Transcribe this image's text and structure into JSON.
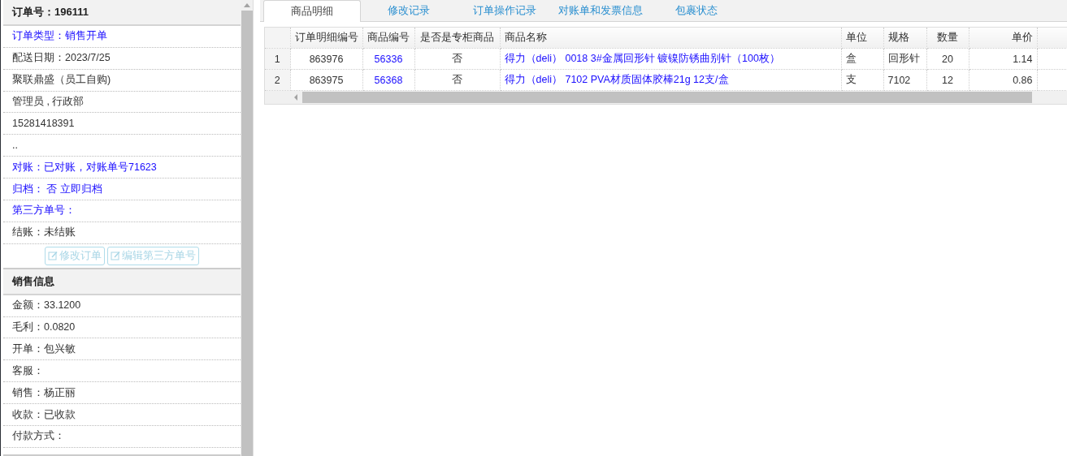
{
  "order_panel": {
    "title": "订单号：196111",
    "items": [
      {
        "text": "订单类型：销售开单",
        "kind": "link"
      },
      {
        "text": "配送日期：2023/7/25",
        "kind": "plain"
      },
      {
        "text": "聚联鼎盛（员工自购)",
        "kind": "plain"
      },
      {
        "text": "管理员 , 行政部",
        "kind": "plain"
      },
      {
        "text": "15281418391",
        "kind": "plain"
      },
      {
        "text": "..",
        "kind": "plain"
      },
      {
        "text": "对账：已对账，对账单号71623",
        "kind": "link"
      },
      {
        "text": "归档： 否 立即归档",
        "kind": "link"
      },
      {
        "text": "第三方单号：",
        "kind": "link"
      },
      {
        "text": "结账：未结账",
        "kind": "plain"
      }
    ],
    "buttons": [
      {
        "label": "修改订单",
        "disabled": true
      },
      {
        "label": "编辑第三方单号",
        "disabled": true
      }
    ]
  },
  "sales_panel": {
    "title": "销售信息",
    "items": [
      {
        "text": "金额：33.1200"
      },
      {
        "text": "毛利：0.0820"
      },
      {
        "text": "开单：包兴敏"
      },
      {
        "text": "客服："
      },
      {
        "text": "销售：杨正丽"
      },
      {
        "text": "收款：已收款"
      },
      {
        "text": "付款方式："
      }
    ]
  },
  "tabs": [
    {
      "label": "商品明细",
      "selected": true
    },
    {
      "label": "修改记录",
      "selected": false
    },
    {
      "label": "订单操作记录",
      "selected": false
    },
    {
      "label": "对账单和发票信息",
      "selected": false
    },
    {
      "label": "包裹状态",
      "selected": false
    }
  ],
  "table": {
    "columns": [
      "订单明细编号",
      "商品编号",
      "是否是专柜商品",
      "商品名称",
      "单位",
      "规格",
      "数量",
      "单价"
    ],
    "rows": [
      {
        "index": "1",
        "cells": [
          "863976",
          "56336",
          "否",
          "得力（deli） 0018 3#金属回形针 镀镍防锈曲别针（100枚）",
          "盒",
          "回形针",
          "20",
          "1.14"
        ]
      },
      {
        "index": "2",
        "cells": [
          "863975",
          "56368",
          "否",
          "得力（deli） 7102 PVA材质固体胶棒21g 12支/盒",
          "支",
          "7102",
          "12",
          "0.86"
        ]
      }
    ]
  }
}
